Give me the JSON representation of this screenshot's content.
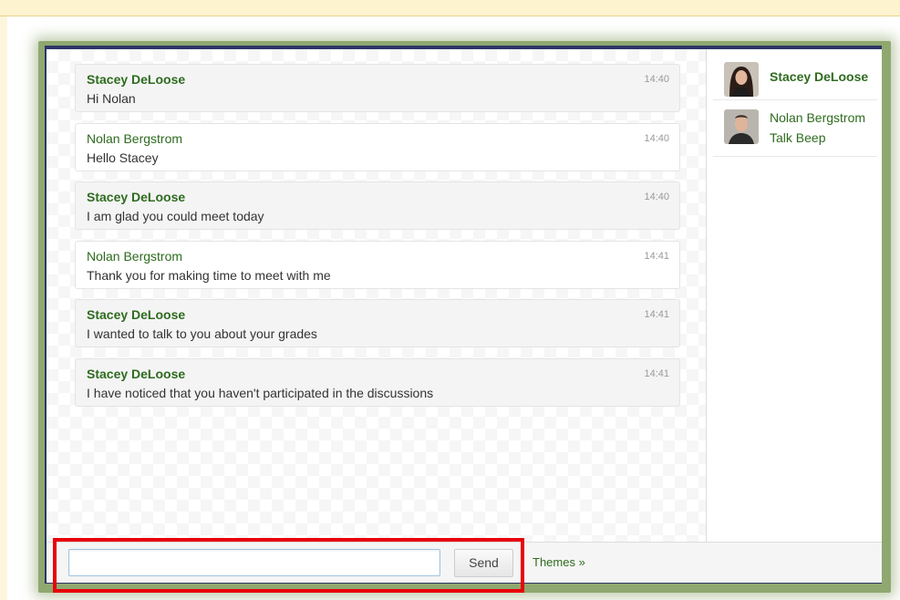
{
  "messages": [
    {
      "sender": "Stacey DeLoose",
      "text": "Hi Nolan",
      "time": "14:40"
    },
    {
      "sender": "Nolan Bergstrom",
      "text": "Hello Stacey",
      "time": "14:40"
    },
    {
      "sender": "Stacey DeLoose",
      "text": "I am glad you could meet today",
      "time": "14:40"
    },
    {
      "sender": "Nolan Bergstrom",
      "text": "Thank you for making time to meet with me",
      "time": "14:41"
    },
    {
      "sender": "Stacey DeLoose",
      "text": "I wanted to talk to you about your grades",
      "time": "14:41"
    },
    {
      "sender": "Stacey DeLoose",
      "text": "I have noticed that you haven't participated in the discussions",
      "time": "14:41"
    }
  ],
  "participants": [
    {
      "name": "Stacey DeLoose",
      "icon": "female-avatar"
    },
    {
      "name": "Nolan Bergstrom",
      "status": "Talk Beep",
      "icon": "male-avatar"
    }
  ],
  "composer": {
    "input_value": "",
    "send_label": "Send",
    "themes_label": "Themes »"
  },
  "colors": {
    "sender_green": "#2e6b1f",
    "frame_green": "#8fa870",
    "highlight_red": "#e8000b"
  }
}
